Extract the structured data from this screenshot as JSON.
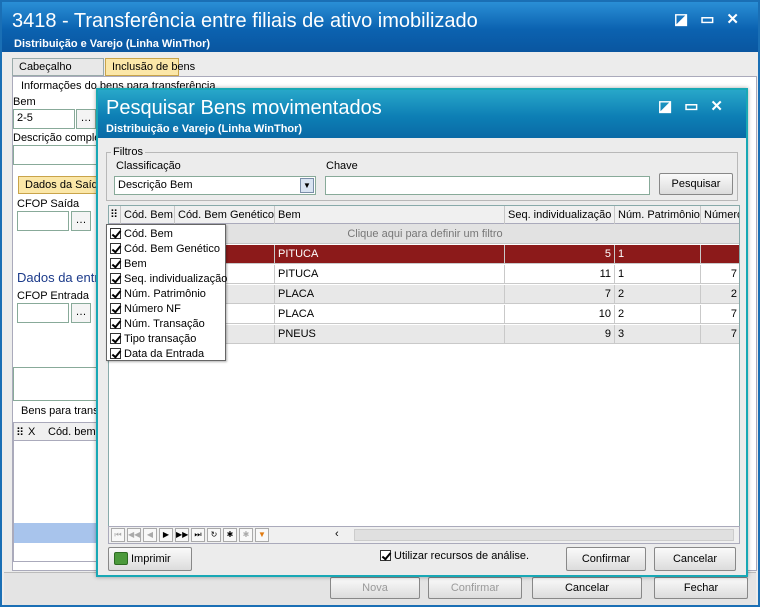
{
  "outer_window": {
    "title": "3418 - Transferência entre filiais de ativo imobilizado",
    "subtitle": "Distribuição e Varejo (Linha WinThor)",
    "tabs": [
      {
        "label": "Cabeçalho",
        "active": false
      },
      {
        "label": "Inclusão de bens",
        "active": true
      }
    ],
    "section_info": "Informações do bens para transferência",
    "bem_label": "Bem",
    "bem_value": "2-5",
    "descricao_label": "Descrição complem",
    "dados_saida_tab": "Dados da Saída",
    "cfop_saida_label": "CFOP Saída",
    "dados_entrada_head": "Dados da entra",
    "cfop_entrada_label": "CFOP Entrada",
    "bens_para_trans_label": "Bens para trans",
    "bens_grid_headers": [
      "X",
      "Cód. bem"
    ],
    "bottom_buttons": [
      {
        "label": "Nova",
        "enabled": false
      },
      {
        "label": "Confirmar",
        "enabled": false
      },
      {
        "label": "Cancelar",
        "enabled": true
      },
      {
        "label": "Fechar",
        "enabled": true
      }
    ]
  },
  "modal": {
    "title": "Pesquisar Bens movimentados",
    "subtitle": "Distribuição e Varejo (Linha WinThor)",
    "filtros_label": "Filtros",
    "classificacao_label": "Classificação",
    "classificacao_value": "Descrição Bem",
    "chave_label": "Chave",
    "chave_value": "",
    "pesquisar_label": "Pesquisar",
    "grid": {
      "headers": [
        "Cód. Bem",
        "Cód. Bem Genético",
        "Bem",
        "Seq. individualização",
        "Núm. Patrimônio",
        "Número"
      ],
      "filter_hint": "Clique aqui para definir um filtro",
      "rows": [
        {
          "bem": "PITUCA",
          "seq": "5",
          "patrimonio": "1",
          "numero": ""
        },
        {
          "bem": "PITUCA",
          "seq": "11",
          "patrimonio": "1",
          "numero": "7"
        },
        {
          "bem": "PLACA",
          "seq": "7",
          "patrimonio": "2",
          "numero": "2"
        },
        {
          "bem": "PLACA",
          "seq": "10",
          "patrimonio": "2",
          "numero": "7"
        },
        {
          "bem": "PNEUS",
          "seq": "9",
          "patrimonio": "3",
          "numero": "7"
        }
      ]
    },
    "column_menu": [
      "Cód. Bem",
      "Cód. Bem Genético",
      "Bem",
      "Seq. individualização",
      "Núm. Patrimônio",
      "Número NF",
      "Núm. Transação",
      "Tipo transação",
      "Data da Entrada"
    ],
    "imprimir_label": "Imprimir",
    "analise_label": "Utilizar recursos de análise.",
    "confirmar_label": "Confirmar",
    "cancelar_label": "Cancelar"
  },
  "colors": {
    "outer_title": "#0b62b0",
    "modal_title": "#0d7fb5",
    "selected_row": "#8c1a1a",
    "tab_active": "#fbe7a8"
  }
}
